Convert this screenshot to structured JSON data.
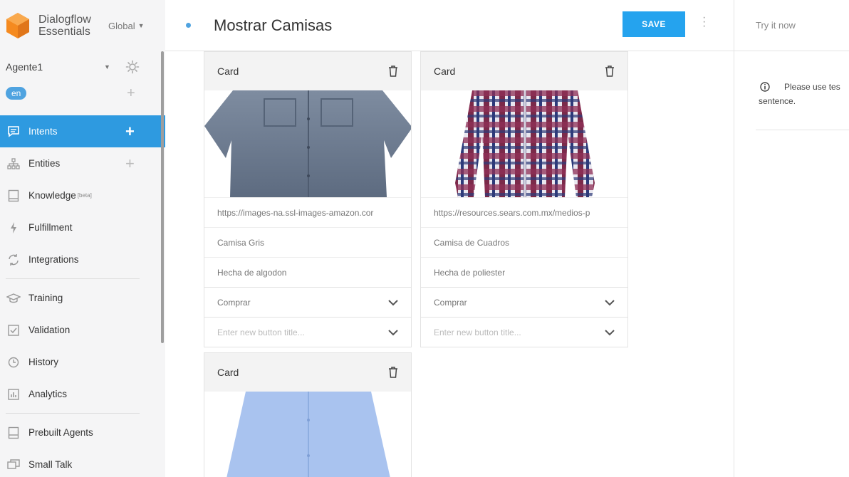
{
  "app": {
    "logo_line1": "Dialogflow",
    "logo_line2": "Essentials",
    "region": "Global",
    "accent": "#2e9ae0",
    "logo_orange": "#f58a1f"
  },
  "agent": {
    "name": "Agente1",
    "language": "en"
  },
  "nav": {
    "items": [
      {
        "label": "Intents",
        "icon": "intents-icon",
        "active": true
      },
      {
        "label": "Entities",
        "icon": "entities-icon"
      },
      {
        "label": "Knowledge",
        "badge": "[beta]",
        "icon": "knowledge-icon"
      },
      {
        "label": "Fulfillment",
        "icon": "fulfillment-icon"
      },
      {
        "label": "Integrations",
        "icon": "integrations-icon"
      },
      {
        "label": "Training",
        "icon": "training-icon"
      },
      {
        "label": "Validation",
        "icon": "validation-icon"
      },
      {
        "label": "History",
        "icon": "history-icon"
      },
      {
        "label": "Analytics",
        "icon": "analytics-icon"
      },
      {
        "label": "Prebuilt Agents",
        "icon": "prebuilt-agents-icon"
      },
      {
        "label": "Small Talk",
        "icon": "small-talk-icon"
      }
    ]
  },
  "header": {
    "intent_name": "Mostrar Camisas",
    "save_label": "SAVE"
  },
  "cards": [
    {
      "header": "Card",
      "image_url": "https://images-na.ssl-images-amazon.cor",
      "title": "Camisa Gris",
      "subtitle": "Hecha de algodon",
      "button": "Comprar",
      "new_button_placeholder": "Enter new button title..."
    },
    {
      "header": "Card",
      "image_url": "https://resources.sears.com.mx/medios-p",
      "title": "Camisa de Cuadros",
      "subtitle": "Hecha de poliester",
      "button": "Comprar",
      "new_button_placeholder": "Enter new button title..."
    },
    {
      "header": "Card"
    }
  ],
  "right_panel": {
    "try_label": "Try it now",
    "info_line1": "Please use tes",
    "info_line2": "sentence."
  }
}
